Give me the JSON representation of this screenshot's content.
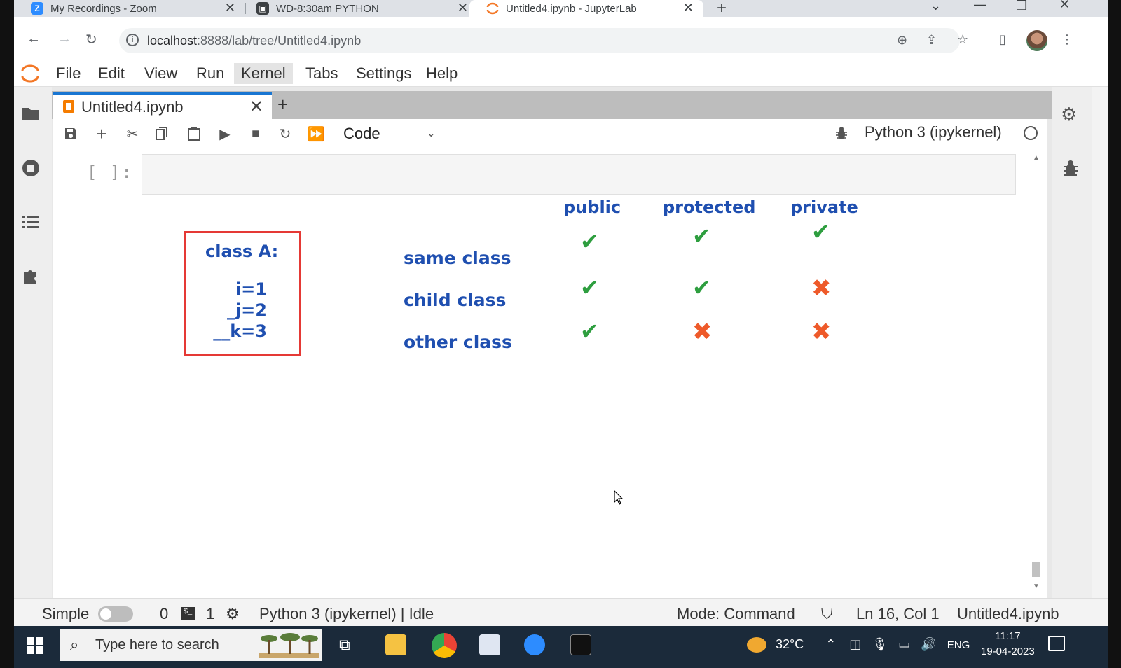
{
  "browser": {
    "tabs": [
      {
        "label": "My Recordings - Zoom",
        "icon": "zoom-icon"
      },
      {
        "label": "WD-8:30am PYTHON",
        "icon": "classroom-icon"
      },
      {
        "label": "Untitled4.ipynb - JupyterLab",
        "icon": "jupyter-icon"
      }
    ],
    "url_host": "localhost",
    "url_rest": ":8888/lab/tree/Untitled4.ipynb"
  },
  "jupyter": {
    "menu": [
      "File",
      "Edit",
      "View",
      "Run",
      "Kernel",
      "Tabs",
      "Settings",
      "Help"
    ],
    "highlighted_menu": "Kernel",
    "notebook_tab": "Untitled4.ipynb",
    "cell_type": "Code",
    "kernel_name": "Python 3 (ipykernel)",
    "cell_prompt": "[ ]:"
  },
  "diagram": {
    "class_title": "class A:",
    "class_lines": [
      "i=1",
      "_j=2",
      "__k=3"
    ],
    "headers": [
      "public",
      "protected",
      "private"
    ],
    "rows": [
      "same class",
      "child class",
      "other class"
    ],
    "access": [
      [
        true,
        true,
        true
      ],
      [
        true,
        true,
        false
      ],
      [
        true,
        false,
        false
      ]
    ],
    "colors": {
      "text": "#1f4fb0",
      "check": "#2e9e3f",
      "cross": "#ee5a2a",
      "box": "#e53935"
    }
  },
  "status": {
    "mode_label": "Simple",
    "count_a": "0",
    "count_b": "1",
    "kernel_status": "Python 3 (ipykernel) | Idle",
    "mode": "Mode: Command",
    "position": "Ln 16, Col 1",
    "file": "Untitled4.ipynb"
  },
  "taskbar": {
    "search_placeholder": "Type here to search",
    "temperature": "32°C",
    "language": "ENG",
    "time": "11:17",
    "date": "19-04-2023"
  }
}
